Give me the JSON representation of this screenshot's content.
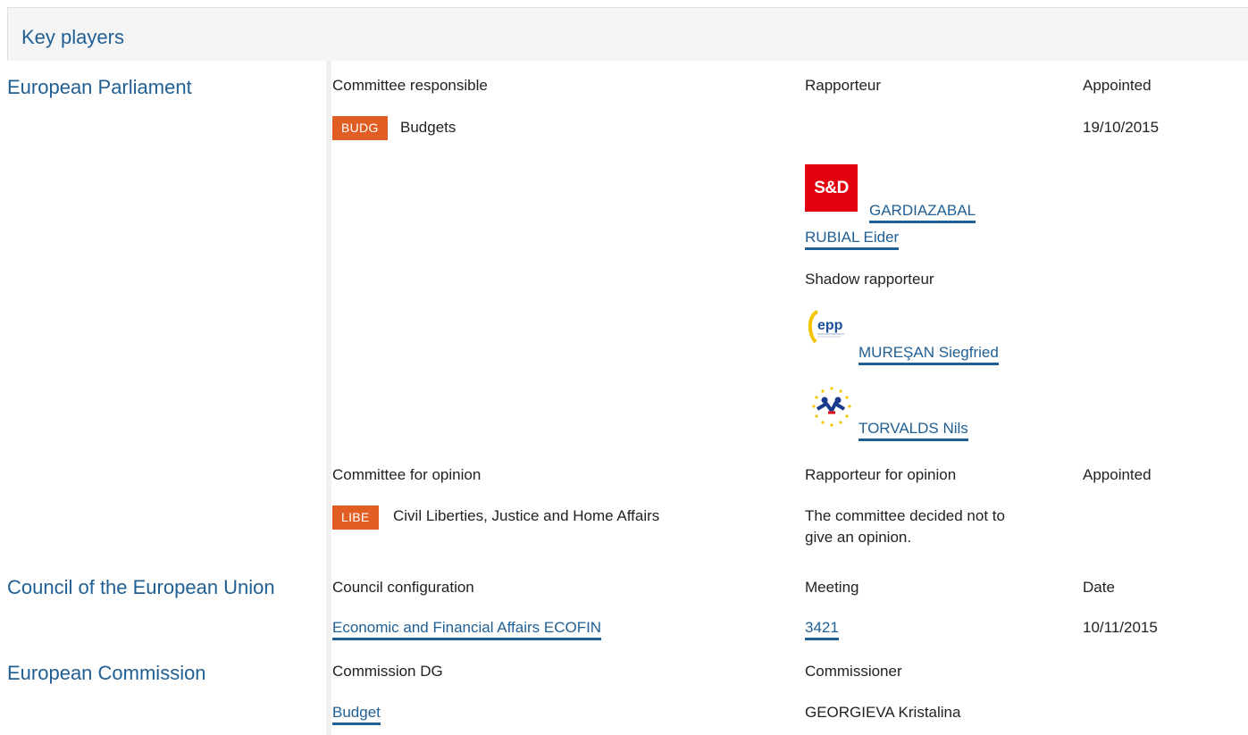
{
  "header": {
    "title": "Key players"
  },
  "parliament": {
    "institution": "European Parliament",
    "committee_col": "Committee responsible",
    "rapporteur_col": "Rapporteur",
    "appointed_col": "Appointed",
    "committee_code": "BUDG",
    "committee_name": "Budgets",
    "appointed_date": "19/10/2015",
    "rapporteur": {
      "group_logo_text": "S&D",
      "name_line1": "GARDIAZABAL",
      "name_line2": "RUBIAL Eider"
    },
    "shadow_label": "Shadow rapporteur",
    "shadows": [
      {
        "group_logo_text": "epp",
        "name": "MUREŞAN Siegfried"
      },
      {
        "group_logo_text": "",
        "name": "TORVALDS Nils"
      }
    ],
    "opinion": {
      "committee_col": "Committee for opinion",
      "rapporteur_col": "Rapporteur for opinion",
      "appointed_col": "Appointed",
      "committee_code": "LIBE",
      "committee_name": "Civil Liberties, Justice and Home Affairs",
      "rapporteur_text_line1": "The committee decided not to",
      "rapporteur_text_line2": "give an opinion."
    }
  },
  "council": {
    "institution": "Council of the European Union",
    "config_col": "Council configuration",
    "meeting_col": "Meeting",
    "date_col": "Date",
    "config_value": "Economic and Financial Affairs ECOFIN",
    "meeting_value": "3421",
    "date_value": "10/11/2015"
  },
  "commission": {
    "institution": "European Commission",
    "dg_col": "Commission DG",
    "commissioner_col": "Commissioner",
    "dg_value": "Budget",
    "commissioner_value": "GEORGIEVA Kristalina"
  },
  "colors": {
    "accent": "#1f5f94",
    "badge": "#e05e23",
    "sd_red": "#e3000f"
  }
}
